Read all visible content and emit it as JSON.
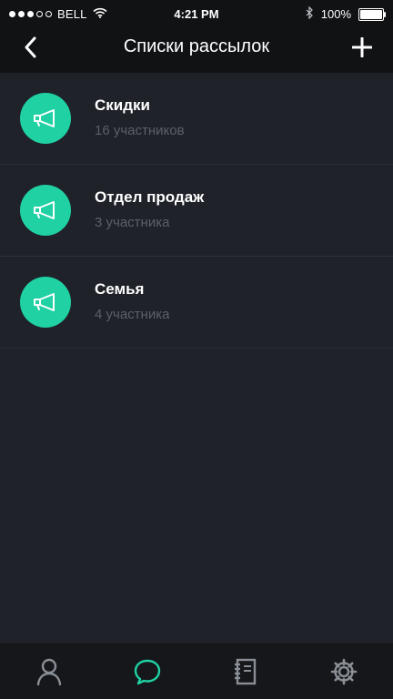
{
  "status_bar": {
    "signal_dots": [
      true,
      true,
      true,
      false,
      false
    ],
    "carrier": "BELL",
    "time": "4:21 PM",
    "battery": "100%",
    "battery_level": 1.0
  },
  "nav": {
    "title": "Списки рассылок",
    "back_icon": "chevron-left-icon",
    "add_icon": "plus-icon"
  },
  "lists": [
    {
      "name": "Скидки",
      "count": "16 участников",
      "icon": "megaphone-icon"
    },
    {
      "name": "Отдел продаж",
      "count": "3 участника",
      "icon": "megaphone-icon"
    },
    {
      "name": "Семья",
      "count": "4 участника",
      "icon": "megaphone-icon"
    }
  ],
  "tabbar": {
    "tabs": [
      {
        "icon": "user-icon",
        "active": false
      },
      {
        "icon": "chat-bubble-icon",
        "active": true
      },
      {
        "icon": "notebook-icon",
        "active": false
      },
      {
        "icon": "gear-icon",
        "active": false
      }
    ]
  },
  "colors": {
    "accent": "#1fd1a3",
    "background": "#1f2229",
    "header": "#111214",
    "tab_inactive": "#8a8f96",
    "muted_text": "#5a606a"
  }
}
